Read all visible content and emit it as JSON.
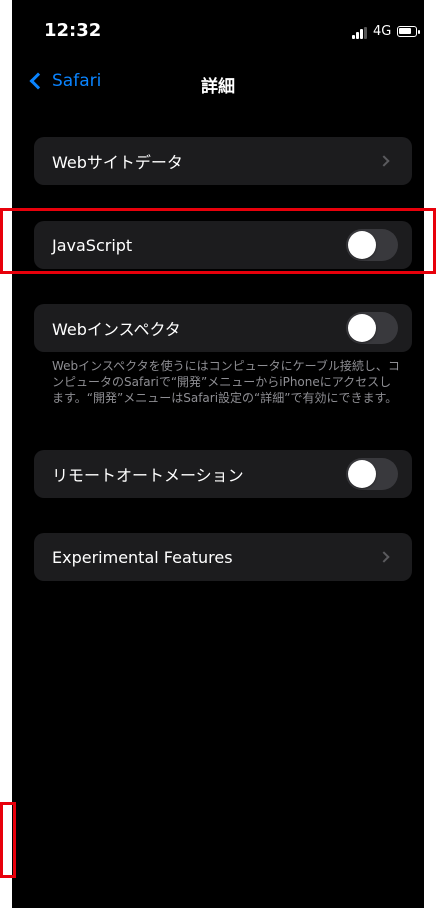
{
  "status_bar": {
    "time": "12:32",
    "network": "4G"
  },
  "nav": {
    "back_label": "Safari",
    "title": "詳細"
  },
  "rows": {
    "website_data": {
      "label": "Webサイトデータ"
    },
    "javascript": {
      "label": "JavaScript",
      "enabled": false
    },
    "web_inspector": {
      "label": "Webインスペクタ",
      "enabled": false
    },
    "remote_automation": {
      "label": "リモートオートメーション",
      "enabled": false
    },
    "experimental": {
      "label": "Experimental Features"
    }
  },
  "footnotes": {
    "web_inspector": "Webインスペクタを使うにはコンピュータにケーブル接続し、コンピュータのSafariで“開発”メニューからiPhoneにアクセスします。“開発”メニューはSafari設定の“詳細”で有効にできます。"
  },
  "colors": {
    "accent": "#0a84ff",
    "cell_background": "#1c1c1e",
    "toggle_off": "#39393d",
    "annotation": "#e8000b"
  }
}
